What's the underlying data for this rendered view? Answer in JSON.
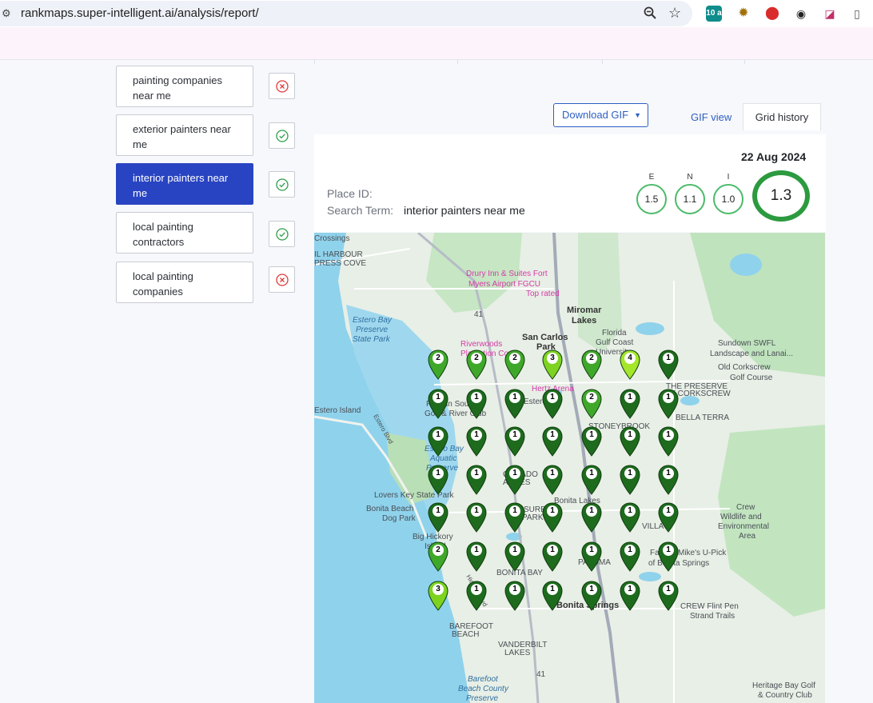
{
  "browser": {
    "url": "rankmaps.super-intelligent.ai/analysis/report/",
    "extension_badge": "10 a"
  },
  "keywords": [
    {
      "label": "painting companies near me",
      "status": "fail"
    },
    {
      "label": "exterior painters near me",
      "status": "ok"
    },
    {
      "label": "interior painters near me",
      "status": "ok",
      "active": true
    },
    {
      "label": "local painting contractors",
      "status": "ok"
    },
    {
      "label": "local painting companies",
      "status": "fail"
    }
  ],
  "toolbar": {
    "download_label": "Download GIF",
    "gif_view_label": "GIF view",
    "grid_history_label": "Grid history"
  },
  "report": {
    "date": "22 Aug 2024",
    "place_id_label": "Place ID:",
    "place_id_value": "",
    "search_term_label": "Search Term:",
    "search_term_value": "interior painters near me",
    "scores": [
      {
        "label": "E",
        "value": "1.5"
      },
      {
        "label": "N",
        "value": "1.1"
      },
      {
        "label": "I",
        "value": "1.0"
      }
    ],
    "overall": "1.3"
  },
  "map": {
    "labels": [
      "Crossings",
      "IL HARBOUR",
      "PRESS COVE",
      "Drury Inn & Suites Fort",
      "Myers Airport FGCU",
      "Top rated",
      "Miromar",
      "Lakes",
      "San Carlos",
      "Park",
      "Florida",
      "Gulf Coast",
      "University",
      "Sundown SWFL",
      "Landscape and Lanai...",
      "Old Corkscrew",
      "Golf Course",
      "Estero Bay",
      "Preserve",
      "State Park",
      "Riverwoods",
      "Plantation Condo",
      "Hertz Arena",
      "THE PRESERVE",
      "AT CORKSCREW",
      "Estero Island",
      "Pelican Sound",
      "Golf & River Club",
      "Estero",
      "STONEYBROOK",
      "BELLA TERRA",
      "Estero Bay",
      "Aquatic",
      "Preserve",
      "CORADO",
      "ACRES",
      "Lovers Key State Park",
      "Bonita Beach",
      "Dog Park",
      "Bonita Lakes",
      "Crew",
      "Wildlife and",
      "Environmental",
      "Area",
      "Big Hickory",
      "Island",
      "SURE",
      "PARK",
      "VILLA",
      "Farmer Mike's U-Pick",
      "of Bonita Springs",
      "BONITA BAY",
      "PALOMA",
      "Bonita Springs",
      "CREW Flint Pen",
      "Strand Trails",
      "BAREFOOT",
      "BEACH",
      "VANDERBILT",
      "LAKES",
      "Barefoot",
      "Beach County",
      "Preserve",
      "Heritage Bay Golf",
      "& Country Club",
      "41",
      "41",
      "Estero Blvd",
      "Hickory Blvd"
    ],
    "grid": [
      [
        "2",
        "2",
        "2",
        "3",
        "2",
        "4",
        "1"
      ],
      [
        "1",
        "1",
        "1",
        "1",
        "2",
        "1",
        "1"
      ],
      [
        "1",
        "1",
        "1",
        "1",
        "1",
        "1",
        "1"
      ],
      [
        "1",
        "1",
        "1",
        "1",
        "1",
        "1",
        "1"
      ],
      [
        "1",
        "1",
        "1",
        "1",
        "1",
        "1",
        "1"
      ],
      [
        "2",
        "1",
        "1",
        "1",
        "1",
        "1",
        "1"
      ],
      [
        "3",
        "1",
        "1",
        "1",
        "1",
        "1",
        "1"
      ]
    ],
    "rank_colors": {
      "1": "#1e6b1e",
      "2": "#3fa82a",
      "3": "#7ed321",
      "4": "#a4e62a"
    }
  }
}
